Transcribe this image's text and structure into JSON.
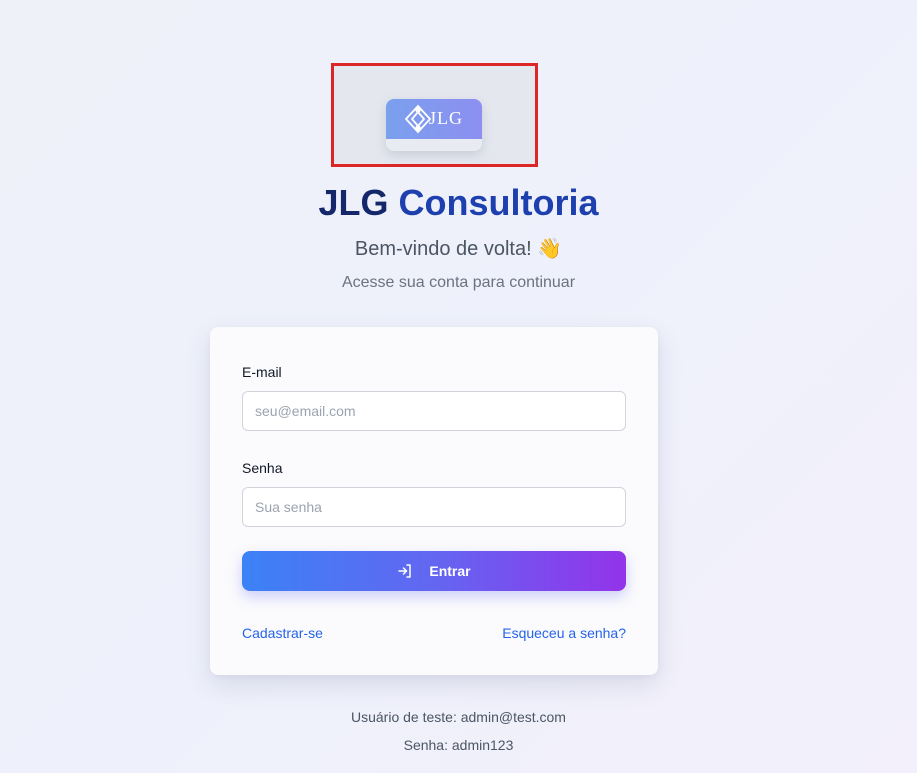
{
  "logo": {
    "text": "JLG",
    "icon": "diamond-logo-icon"
  },
  "brand": {
    "title_part1": "JLG ",
    "title_part2": "Consultoria"
  },
  "welcome": {
    "text": "Bem-vindo de volta!",
    "emoji": "👋"
  },
  "subtitle": "Acesse sua conta para continuar",
  "form": {
    "email_label": "E-mail",
    "email_placeholder": "seu@email.com",
    "email_value": "",
    "password_label": "Senha",
    "password_placeholder": "Sua senha",
    "password_value": "",
    "submit_label": "Entrar",
    "submit_icon": "login-icon"
  },
  "links": {
    "register": "Cadastrar-se",
    "forgot_password": "Esqueceu a senha?"
  },
  "footer": {
    "test_user": "Usuário de teste: admin@test.com",
    "test_password": "Senha: admin123"
  },
  "colors": {
    "highlight_border": "#dc2626",
    "title_dark": "#15276b",
    "title_blue": "#1e40af",
    "link": "#2563eb",
    "button_gradient_start": "#3b82f6",
    "button_gradient_end": "#9333ea"
  }
}
